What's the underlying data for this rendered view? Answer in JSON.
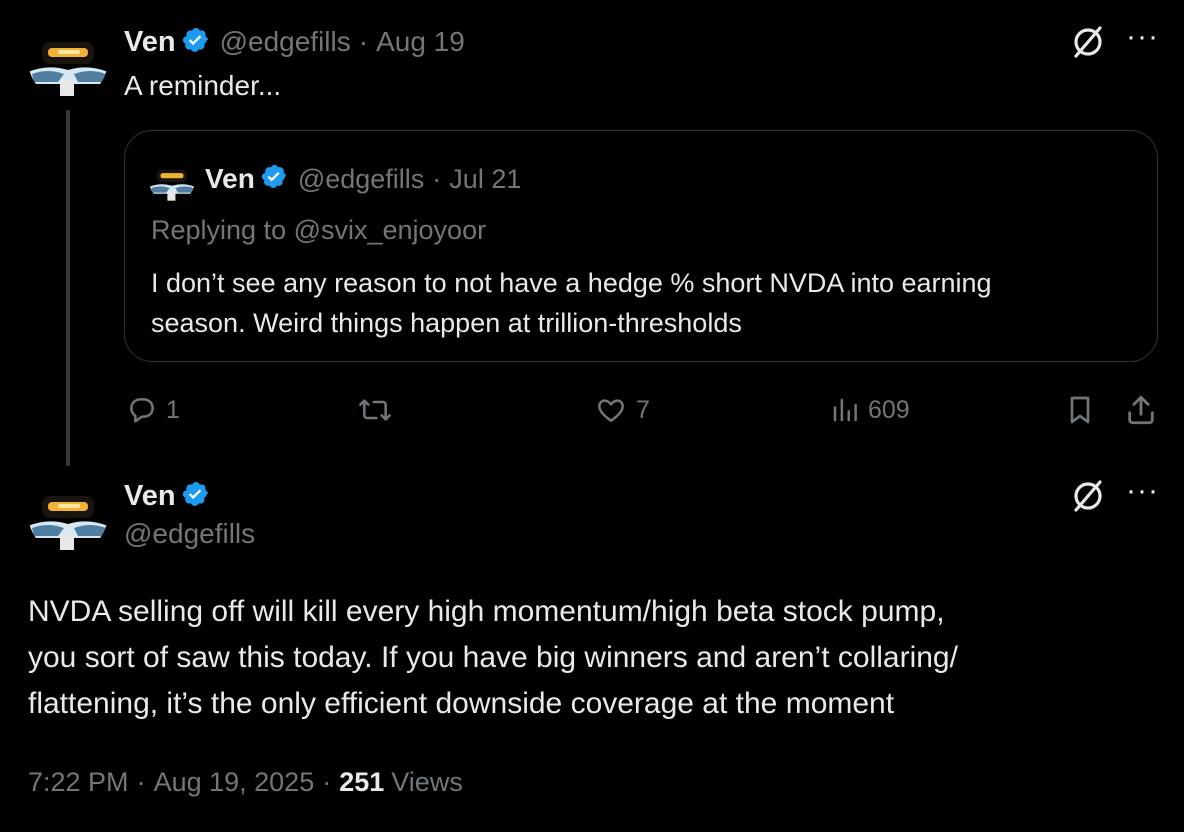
{
  "tweet": {
    "author": {
      "name": "Ven",
      "handle": "@edgefills"
    },
    "date_sep": "·",
    "date": "Aug 19",
    "text": "A reminder...",
    "quote": {
      "author": {
        "name": "Ven",
        "handle": "@edgefills"
      },
      "date_sep": "·",
      "date": "Jul 21",
      "replying_to": "Replying to @svix_enjoyoor",
      "text_line1": "I don’t see any reason to not have a hedge % short NVDA into earning",
      "text_line2": "season. Weird things happen at trillion-thresholds"
    },
    "actions": {
      "replies": "1",
      "reposts": "",
      "likes": "7",
      "views": "609"
    }
  },
  "main_tweet": {
    "author": {
      "name": "Ven",
      "handle": "@edgefills"
    },
    "text_line1": "NVDA selling off will kill every high momentum/high beta stock pump,",
    "text_line2": "you sort of saw this today. If you have big winners and aren’t collaring/",
    "text_line3": "flattening, it’s the only efficient downside coverage at the moment",
    "time": "7:22 PM",
    "sep1": "·",
    "date": "Aug 19, 2025",
    "sep2": "·",
    "view_count": "251",
    "views_label": "Views"
  },
  "icons": [
    "grok-icon",
    "more-icon",
    "verified-icon",
    "reply-icon",
    "repost-icon",
    "like-icon",
    "views-icon",
    "bookmark-icon",
    "share-icon"
  ],
  "colors": {
    "background": "#000000",
    "text": "#e7e9ea",
    "secondary": "#71767b",
    "verified": "#1d9bf0",
    "border": "#2f3336"
  }
}
